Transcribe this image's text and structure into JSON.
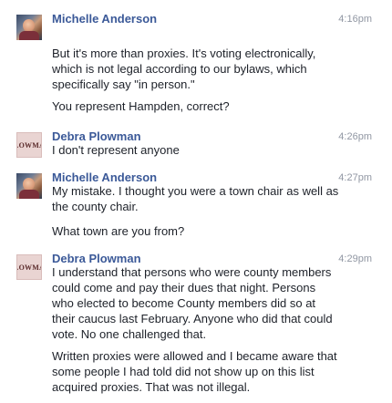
{
  "messages": [
    {
      "sender": "Michelle Anderson",
      "time": "4:16pm",
      "avatar": "profile-photo",
      "paragraphs": [
        "But it's more than proxies. It's voting electronically, which is not legal according to our bylaws, which specifically say \"in person.\"",
        "You represent Hampden, correct?"
      ]
    },
    {
      "sender": "Debra Plowman",
      "time": "4:26pm",
      "avatar": "logo",
      "avatar_text": "LOWMA",
      "paragraphs": [
        "I don't represent anyone"
      ]
    },
    {
      "sender": "Michelle Anderson",
      "time": "4:27pm",
      "avatar": "profile-photo",
      "paragraphs": [
        "My mistake. I thought you were a town chair as well as the county chair.",
        "What town are you from?"
      ]
    },
    {
      "sender": "Debra Plowman",
      "time": "4:29pm",
      "avatar": "logo",
      "avatar_text": "LOWMA",
      "paragraphs": [
        "I understand that persons who were county members could come and pay their dues that night. Persons who elected to become County members did so at their caucus last February. Anyone who did that could vote. No one challenged that.",
        "Written proxies were allowed and I became aware that some people I had told did not show up on this list acquired proxies. That was not illegal."
      ]
    }
  ]
}
